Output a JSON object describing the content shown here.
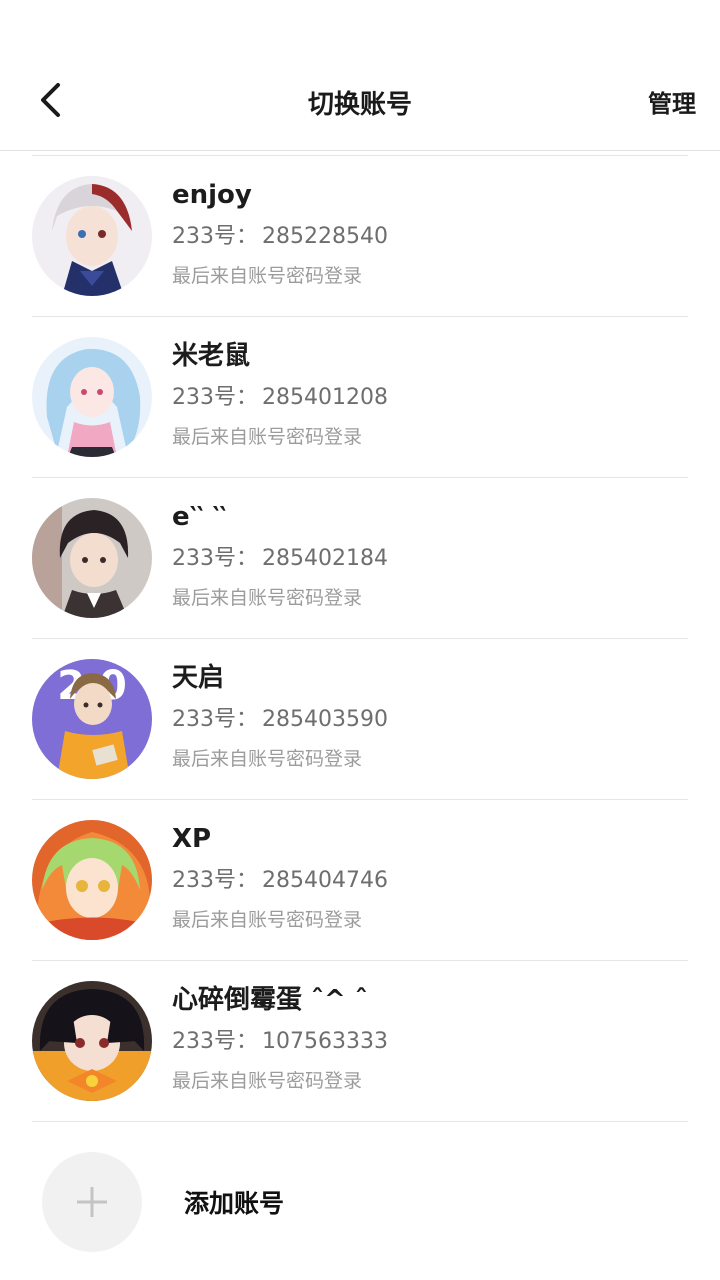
{
  "header": {
    "title": "切换账号",
    "manage_label": "管理"
  },
  "accounts": [
    {
      "name": "enjoy",
      "id_prefix": "233号：",
      "id": "285228540",
      "login_method": "最后来自账号密码登录",
      "avatar_icon": "anime-avatar-red-white-hair"
    },
    {
      "name": "米老鼠",
      "id_prefix": "233号：",
      "id": "285401208",
      "login_method": "最后来自账号密码登录",
      "avatar_icon": "anime-avatar-blue-hair-pink-sweater"
    },
    {
      "name": "e‵‵ ‵‵",
      "id_prefix": "233号：",
      "id": "285402184",
      "login_method": "最后来自账号密码登录",
      "avatar_icon": "anime-avatar-dark-hair-boy"
    },
    {
      "name": "天启",
      "id_prefix": "233号：",
      "id": "285403590",
      "login_method": "最后来自账号密码登录",
      "avatar_icon": "anime-avatar-yellow-hoodie-purple-bg"
    },
    {
      "name": "XP",
      "id_prefix": "233号：",
      "id": "285404746",
      "login_method": "最后来自账号密码登录",
      "avatar_icon": "anime-avatar-green-hair"
    },
    {
      "name": "心碎倒霉蛋 ˆ^ ˆ",
      "id_prefix": "233号：",
      "id": "107563333",
      "login_method": "最后来自账号密码登录",
      "avatar_icon": "anime-avatar-black-hair-orange-bow"
    }
  ],
  "add_account": {
    "label": "添加账号"
  }
}
